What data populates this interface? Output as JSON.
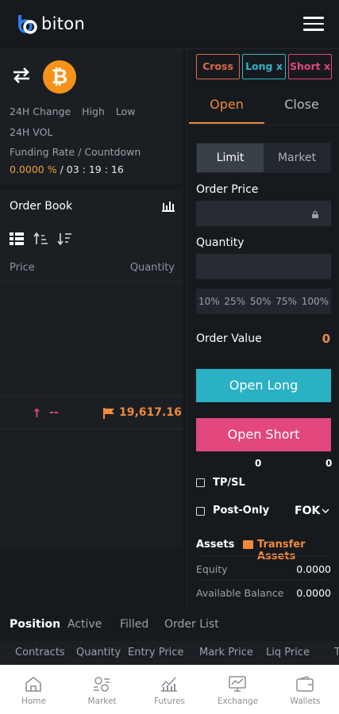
{
  "header": {
    "logo_text": "biton",
    "menu_icon": "hamburger-menu-icon"
  },
  "ticker": {
    "swap_icon": "swap-arrows-icon",
    "coin_icon": "bitcoin-icon",
    "coin_symbol": "₿",
    "change_label": "24H Change",
    "high_label": "High",
    "low_label": "Low",
    "vol_label": "24H VOL",
    "funding_label": "Funding Rate / Countdown",
    "funding_rate": "0.0000 %",
    "countdown": " / 03 : 19 : 16"
  },
  "orderbook": {
    "title": "Order Book",
    "price_header": "Price",
    "quantity_header": "Quantity",
    "last_dash": "--",
    "last_price": "19,617.16",
    "colors": {
      "up": "#e2477e",
      "price": "#f08a3c"
    }
  },
  "margin": {
    "cross": "Cross",
    "long": "Long x",
    "short": "Short x"
  },
  "trade_tabs": {
    "open": "Open",
    "close": "Close"
  },
  "order_type": {
    "limit": "Limit",
    "market": "Market"
  },
  "form": {
    "price_label": "Order Price",
    "price_value": "",
    "quantity_label": "Quantity",
    "quantity_value": "",
    "percentages": [
      "10%",
      "25%",
      "50%",
      "75%",
      "100%"
    ],
    "order_value_label": "Order Value",
    "order_value": "0",
    "open_long": "Open Long",
    "open_short": "Open Short",
    "long_avail": "0",
    "short_avail": "0",
    "tpsl_label": "TP/SL",
    "post_only_label": "Post-Only",
    "tif": "FOK"
  },
  "assets": {
    "title": "Assets",
    "transfer_label": "Transfer Assets",
    "equity_label": "Equity",
    "equity_value": "0.0000",
    "available_label": "Available Balance",
    "available_value": "0.0000"
  },
  "positions": {
    "tabs": [
      "Position",
      "Active",
      "Filled",
      "Order List"
    ],
    "columns": [
      "Contracts",
      "Quantity",
      "Entry Price",
      "Mark Price",
      "Liq Price",
      "T"
    ]
  },
  "nav": {
    "items": [
      {
        "label": "Home",
        "icon": "home-icon"
      },
      {
        "label": "Market",
        "icon": "market-icon"
      },
      {
        "label": "Futures",
        "icon": "futures-chart-icon"
      },
      {
        "label": "Exchange",
        "icon": "exchange-icon"
      },
      {
        "label": "Wallets",
        "icon": "wallet-icon"
      }
    ]
  },
  "colors": {
    "background": "#161a1e",
    "accent": "#f08a3c",
    "long": "#2ab1c3",
    "short": "#e2477e",
    "bitcoin": "#f7931a"
  }
}
